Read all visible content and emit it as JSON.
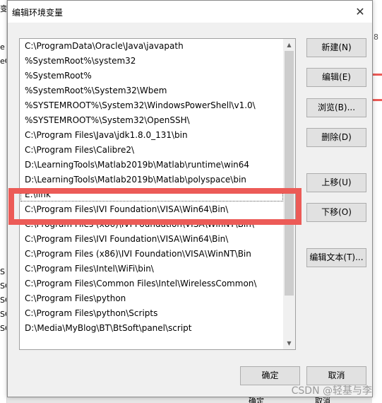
{
  "background": {
    "left_fragments": [
      "变",
      "e",
      "eC",
      "",
      "S",
      "SC",
      "SC",
      "SC",
      "SC"
    ],
    "right_fragments": [
      "8",
      "",
      "",
      "",
      "",
      "",
      "",
      ""
    ],
    "bottom_fragments": [
      "确定",
      "取消"
    ]
  },
  "dialog": {
    "title": "编辑环境变量",
    "close_symbol": "✕"
  },
  "list": {
    "items": [
      "C:\\ProgramData\\Oracle\\Java\\javapath",
      "%SystemRoot%\\system32",
      "%SystemRoot%",
      "%SystemRoot%\\System32\\Wbem",
      "%SYSTEMROOT%\\System32\\WindowsPowerShell\\v1.0\\",
      "%SYSTEMROOT%\\System32\\OpenSSH\\",
      "C:\\Program Files\\Java\\jdk1.8.0_131\\bin",
      "C:\\Program Files\\Calibre2\\",
      "D:\\LearningTools\\Matlab2019b\\Matlab\\runtime\\win64",
      "D:\\LearningTools\\Matlab2019b\\Matlab\\polyspace\\bin",
      "E:\\link",
      "C:\\Program Files\\IVI Foundation\\VISA\\Win64\\Bin\\",
      "C:\\Program Files (x86)\\IVI Foundation\\VISA\\WinNT\\Bin\\",
      "C:\\Program Files\\IVI Foundation\\VISA\\Win64\\Bin\\",
      "C:\\Program Files (x86)\\IVI Foundation\\VISA\\WinNT\\Bin",
      "C:\\Program Files\\Intel\\WiFi\\bin\\",
      "C:\\Program Files\\Common Files\\Intel\\WirelessCommon\\",
      "C:\\Program Files\\python",
      "C:\\Program Files\\python\\Scripts",
      "D:\\Media\\MyBlog\\BT\\BtSoft\\panel\\script"
    ],
    "selected_index": 10,
    "scroll_up_symbol": "▲",
    "scroll_down_symbol": "▼"
  },
  "buttons": {
    "new": "新建(N)",
    "edit": "编辑(E)",
    "browse": "浏览(B)...",
    "delete": "删除(D)",
    "move_up": "上移(U)",
    "move_down": "下移(O)",
    "edit_text": "编辑文本(T)...",
    "ok": "确定",
    "cancel": "取消"
  },
  "highlight_color": "#ec5b57",
  "watermark": "CSDN @轻基与李"
}
